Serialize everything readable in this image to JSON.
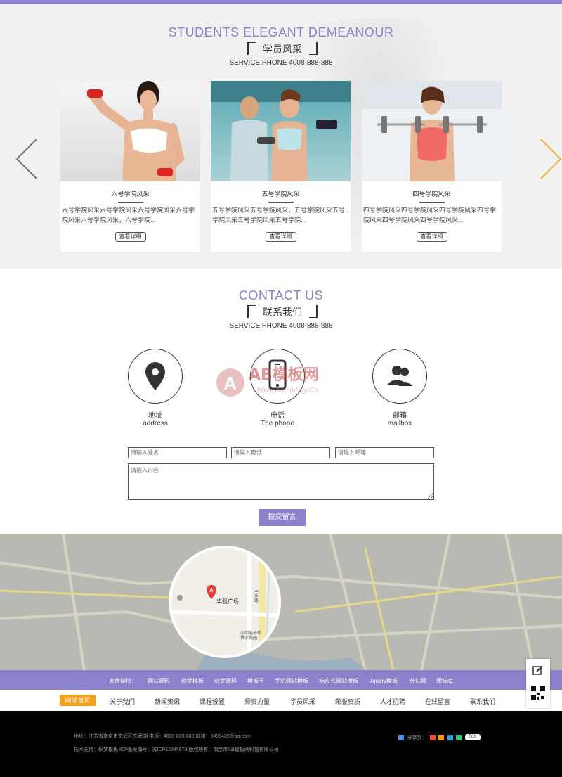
{
  "students": {
    "title_en": "STUDENTS ELEGANT DEMEANOUR",
    "title_cn": "学员风采",
    "phone": "SERVICE PHONE 4008-888-888",
    "cards": [
      {
        "title": "六号学院风采",
        "desc": "六号学院风采六号学院风采六号学院风采六号学院风采六号学院风采，六号学院...",
        "more": "查看详细"
      },
      {
        "title": "五号学院风采",
        "desc": "五号学院风采五号学院风采，五号学院风采五号学院风采五号学院风采五号学院...",
        "more": "查看详细"
      },
      {
        "title": "四号学院风采",
        "desc": "四号学院风采四号学院风采四号学院风采四号学院风采四号学院风采四号学院风采...",
        "more": "查看详细"
      }
    ]
  },
  "contact": {
    "title_en": "CONTACT US",
    "title_cn": "联系我们",
    "phone": "SERVICE PHONE 4008-888-888",
    "items": [
      {
        "icon": "location-icon",
        "cn": "地址",
        "en": "address"
      },
      {
        "icon": "phone-icon",
        "cn": "电话",
        "en": "The phone"
      },
      {
        "icon": "contacts-icon",
        "cn": "邮箱",
        "en": "mailbox"
      }
    ],
    "form": {
      "name_placeholder": "请输入姓名",
      "phone_placeholder": "请输入电话",
      "email_placeholder": "请输入邮箱",
      "content_placeholder": "请输入内容",
      "submit": "提交留言"
    },
    "watermark": {
      "text": "AB模板网",
      "url": "Www.AdminBuy.Cn"
    }
  },
  "map": {
    "center_label": "华强广场",
    "sub_label": "中国电子新 界业路园",
    "marker": "A",
    "road_label": "三东路"
  },
  "links": {
    "label": "友情链接：",
    "items": [
      "网站源码",
      "织梦模板",
      "织梦源码",
      "模板王",
      "手机网站模板",
      "响应式网站模板",
      "Jquery模板",
      "分站网",
      "图标库"
    ]
  },
  "nav": {
    "active": "网站首页",
    "items": [
      "关于我们",
      "新闻资讯",
      "课程设置",
      "师资力量",
      "学员风采",
      "荣誉资质",
      "人才招聘",
      "在线留言",
      "联系我们"
    ]
  },
  "footer": {
    "line1": "地址：江苏省南京市玄武区玄武湖   电话：4000-000-000   邮箱：9490489@qq.com",
    "line2": "技术支持：织梦模板   ICP备案编号：苏ICP12345678   版权所有：南京市AB模板网科技有限公司",
    "share_label": "分享到：",
    "share_count": "506"
  },
  "colors": {
    "accent": "#8c82cc",
    "nav_active": "#f4a11c",
    "footer_bg": "#000000"
  }
}
